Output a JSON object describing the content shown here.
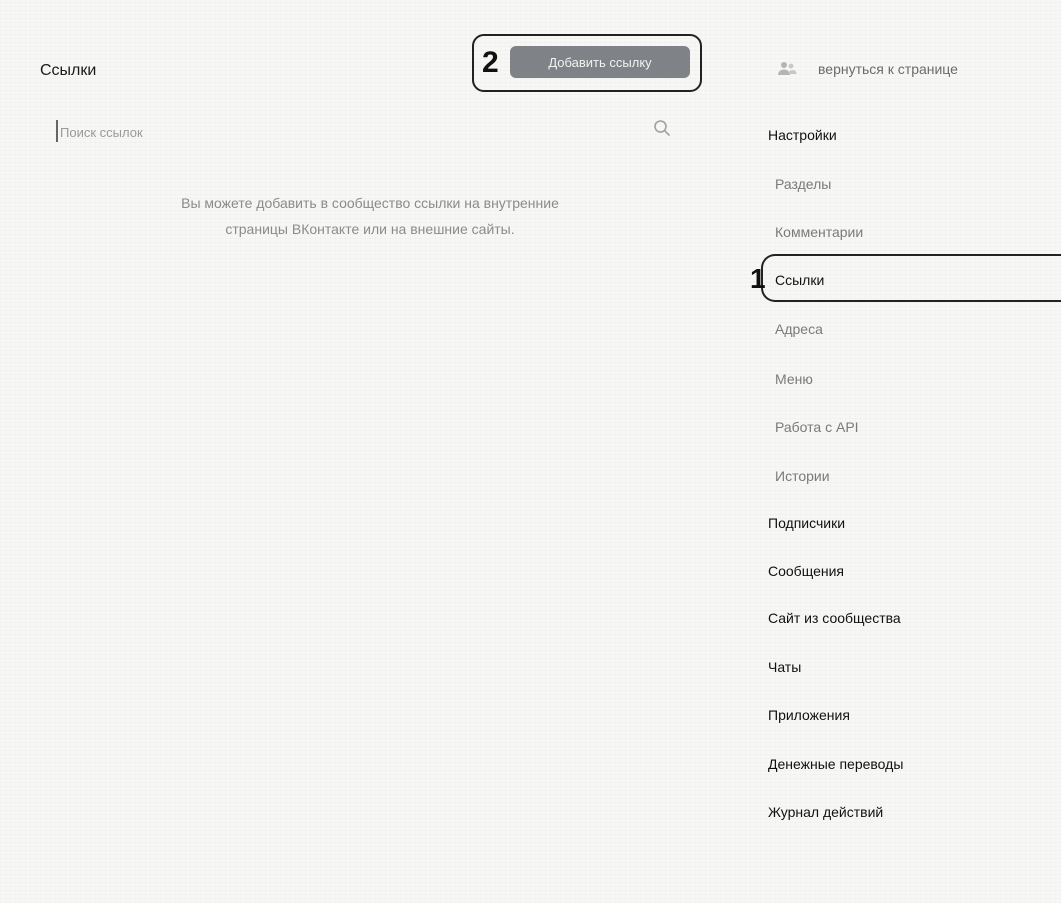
{
  "main": {
    "title": "Ссылки",
    "add_button_label": "Добавить ссылку",
    "search_placeholder": "Поиск ссылок",
    "empty_text_line1": "Вы можете добавить в сообщество ссылки на внутренние",
    "empty_text_line2": "страницы ВКонтакте или на внешние сайты."
  },
  "annotations": {
    "marker_1": "1",
    "marker_2": "2"
  },
  "sidebar": {
    "back_label": "вернуться к странице",
    "settings_label": "Настройки",
    "sub_items": [
      {
        "label": "Разделы"
      },
      {
        "label": "Комментарии"
      },
      {
        "label": "Ссылки"
      },
      {
        "label": "Адреса"
      },
      {
        "label": "Меню"
      },
      {
        "label": "Работа с API"
      },
      {
        "label": "Истории"
      }
    ],
    "items": [
      {
        "label": "Подписчики"
      },
      {
        "label": "Сообщения"
      },
      {
        "label": "Сайт из сообщества"
      },
      {
        "label": "Чаты"
      },
      {
        "label": "Приложения"
      },
      {
        "label": "Денежные переводы"
      },
      {
        "label": "Журнал действий"
      }
    ]
  },
  "icons": {
    "search": "search-icon",
    "back": "people-icon"
  }
}
